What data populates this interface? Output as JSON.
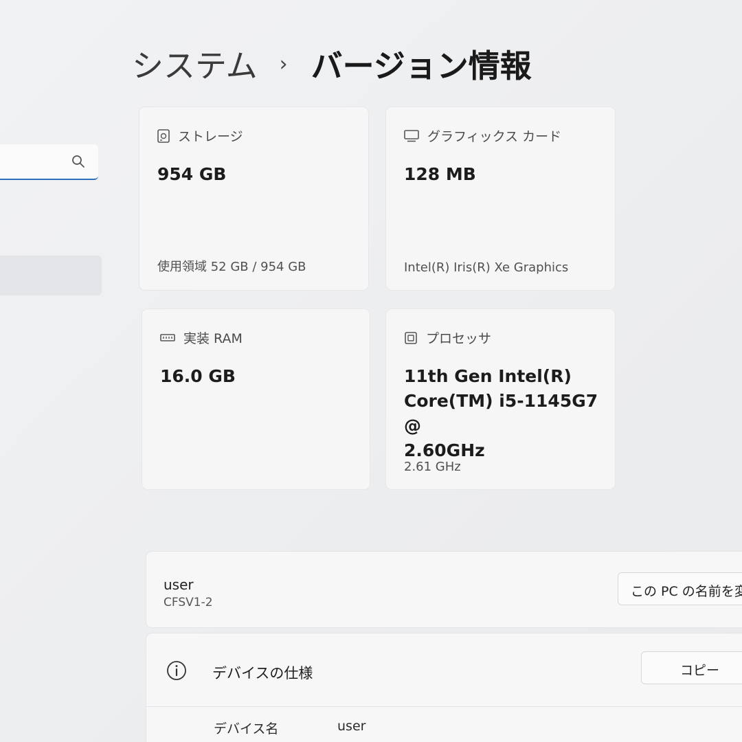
{
  "breadcrumb": {
    "parent": "システム",
    "separator": "›",
    "current": "バージョン情報"
  },
  "nav": {
    "search_icon": "search-icon"
  },
  "cards": {
    "storage": {
      "icon": "storage-icon",
      "title": "ストレージ",
      "value": "954 GB",
      "sub": "使用領域 52 GB / 954 GB"
    },
    "graphics": {
      "icon": "display-icon",
      "title": "グラフィックス カード",
      "value": "128 MB",
      "sub": "Intel(R) Iris(R) Xe Graphics"
    },
    "ram": {
      "icon": "memory-icon",
      "title": "実装 RAM",
      "value": "16.0 GB"
    },
    "processor": {
      "icon": "processor-icon",
      "title": "プロセッサ",
      "value_line1": "11th Gen Intel(R)",
      "value_line2": "Core(TM) i5-1145G7 @",
      "value_line3": "2.60GHz",
      "sub": "2.61 GHz"
    }
  },
  "device": {
    "user": "user",
    "model": "CFSV1-2",
    "rename_label": "この PC の名前を変"
  },
  "specs": {
    "title": "デバイスの仕様",
    "copy_label": "コピー",
    "rows": [
      {
        "label": "デバイス名",
        "value": "user"
      }
    ]
  },
  "colors": {
    "accent": "#2f6fb8",
    "background": "#eeeff1",
    "card": "#f6f6f7"
  }
}
